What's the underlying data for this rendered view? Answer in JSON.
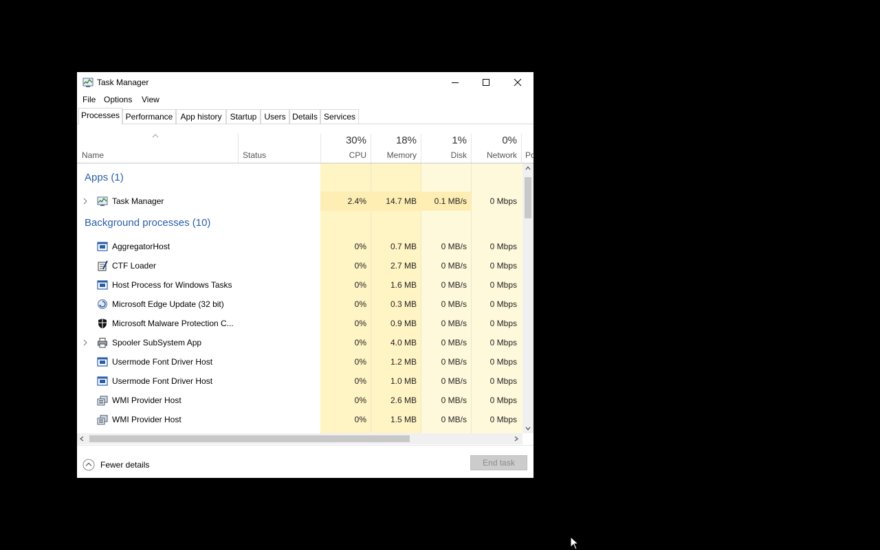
{
  "window": {
    "title": "Task Manager"
  },
  "menu": [
    "File",
    "Options",
    "View"
  ],
  "tabs": [
    "Processes",
    "Performance",
    "App history",
    "Startup",
    "Users",
    "Details",
    "Services"
  ],
  "columns": {
    "name": "Name",
    "status": "Status",
    "cpu": {
      "pct": "30%",
      "label": "CPU"
    },
    "memory": {
      "pct": "18%",
      "label": "Memory"
    },
    "disk": {
      "pct": "1%",
      "label": "Disk"
    },
    "network": {
      "pct": "0%",
      "label": "Network"
    },
    "power_partial": "Po"
  },
  "groups": {
    "apps": "Apps (1)",
    "background": "Background processes (10)"
  },
  "apps": [
    {
      "name": "Task Manager",
      "icon": "task-manager-icon",
      "expandable": true,
      "cpu": "2.4%",
      "memory": "14.7 MB",
      "disk": "0.1 MB/s",
      "network": "0 Mbps"
    }
  ],
  "background": [
    {
      "name": "AggregatorHost",
      "icon": "window-icon",
      "expandable": false,
      "cpu": "0%",
      "memory": "0.7 MB",
      "disk": "0 MB/s",
      "network": "0 Mbps"
    },
    {
      "name": "CTF Loader",
      "icon": "ctf-loader-icon",
      "expandable": false,
      "cpu": "0%",
      "memory": "2.7 MB",
      "disk": "0 MB/s",
      "network": "0 Mbps"
    },
    {
      "name": "Host Process for Windows Tasks",
      "icon": "window-icon",
      "expandable": false,
      "cpu": "0%",
      "memory": "1.6 MB",
      "disk": "0 MB/s",
      "network": "0 Mbps"
    },
    {
      "name": "Microsoft Edge Update (32 bit)",
      "icon": "edge-update-icon",
      "expandable": false,
      "cpu": "0%",
      "memory": "0.3 MB",
      "disk": "0 MB/s",
      "network": "0 Mbps"
    },
    {
      "name": "Microsoft Malware Protection C...",
      "icon": "shield-icon",
      "expandable": false,
      "cpu": "0%",
      "memory": "0.9 MB",
      "disk": "0 MB/s",
      "network": "0 Mbps"
    },
    {
      "name": "Spooler SubSystem App",
      "icon": "printer-icon",
      "expandable": true,
      "cpu": "0%",
      "memory": "4.0 MB",
      "disk": "0 MB/s",
      "network": "0 Mbps"
    },
    {
      "name": "Usermode Font Driver Host",
      "icon": "window-icon",
      "expandable": false,
      "cpu": "0%",
      "memory": "1.2 MB",
      "disk": "0 MB/s",
      "network": "0 Mbps"
    },
    {
      "name": "Usermode Font Driver Host",
      "icon": "window-icon",
      "expandable": false,
      "cpu": "0%",
      "memory": "1.0 MB",
      "disk": "0 MB/s",
      "network": "0 Mbps"
    },
    {
      "name": "WMI Provider Host",
      "icon": "wmi-icon",
      "expandable": false,
      "cpu": "0%",
      "memory": "2.6 MB",
      "disk": "0 MB/s",
      "network": "0 Mbps"
    },
    {
      "name": "WMI Provider Host",
      "icon": "wmi-icon",
      "expandable": false,
      "cpu": "0%",
      "memory": "1.5 MB",
      "disk": "0 MB/s",
      "network": "0 Mbps"
    }
  ],
  "footer": {
    "fewer_details": "Fewer details",
    "end_task": "End task"
  },
  "colors": {
    "cpu_band": "#fff4c4",
    "light_band": "#fff9db",
    "memory_highlight": "#ffeeb3",
    "group_text": "#2a5ea6"
  }
}
